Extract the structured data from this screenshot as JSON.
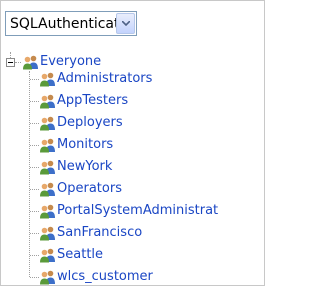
{
  "realm_select": {
    "value": "SQLAuthenticator"
  },
  "tree": {
    "root": {
      "label": "Everyone",
      "icon": "group-icon"
    },
    "children": [
      {
        "label": "Administrators",
        "icon": "group-icon"
      },
      {
        "label": "AppTesters",
        "icon": "group-icon"
      },
      {
        "label": "Deployers",
        "icon": "group-icon"
      },
      {
        "label": "Monitors",
        "icon": "group-icon"
      },
      {
        "label": "NewYork",
        "icon": "group-icon"
      },
      {
        "label": "Operators",
        "icon": "group-icon"
      },
      {
        "label": "PortalSystemAdministrat",
        "icon": "group-icon"
      },
      {
        "label": "SanFrancisco",
        "icon": "group-icon"
      },
      {
        "label": "Seattle",
        "icon": "group-icon"
      },
      {
        "label": "wlcs_customer",
        "icon": "group-icon"
      }
    ]
  },
  "colors": {
    "link": "#1a46c4",
    "border": "#7f9db9"
  }
}
